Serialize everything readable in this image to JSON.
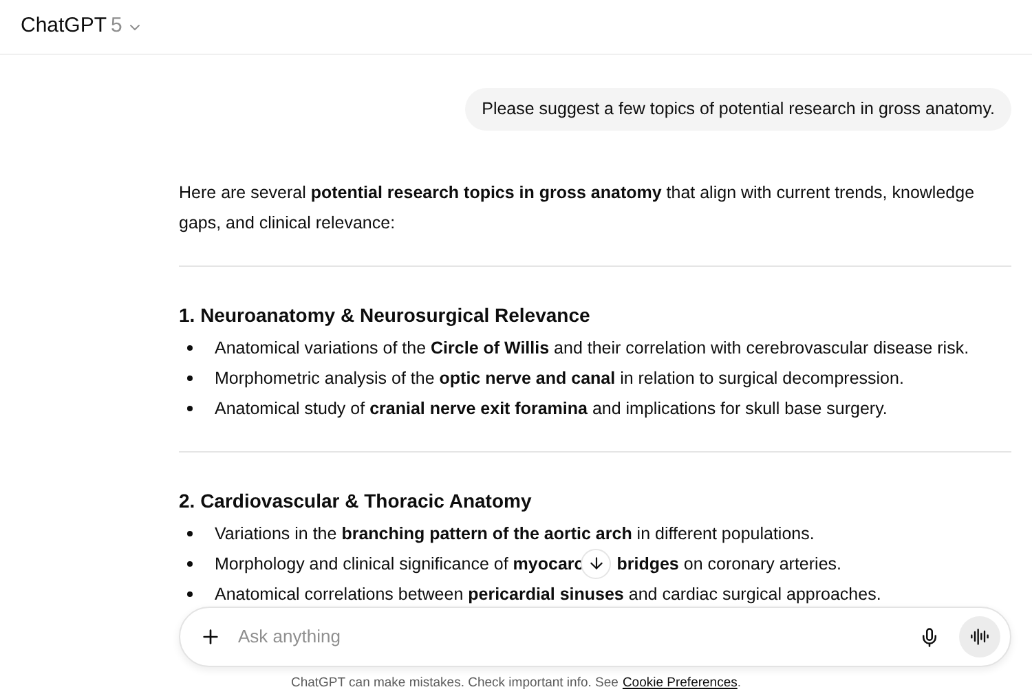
{
  "header": {
    "title": "ChatGPT",
    "version": "5"
  },
  "user_message": "Please suggest a few topics of potential research in gross anatomy.",
  "reply": {
    "intro": "Here are several **potential research topics in gross anatomy** that align with current trends, knowledge gaps, and clinical relevance:",
    "sections": [
      {
        "heading": "1. Neuroanatomy & Neurosurgical Relevance",
        "bullets": [
          {
            "parts": [
              "Anatomical variations of the **Circle of Willis** and their correlation with cerebrovascular disease risk."
            ]
          },
          {
            "parts": [
              "Morphometric analysis of the **optic nerve and canal** in relation to surgical decompression."
            ]
          },
          {
            "parts": [
              "Anatomical study of **cranial nerve exit foramina** and implications for skull base surgery."
            ]
          }
        ]
      },
      {
        "heading": "2. Cardiovascular & Thoracic Anatomy",
        "bullets": [
          {
            "parts": [
              "Variations in the **branching pattern of the aortic arch** in different populations."
            ]
          },
          {
            "parts": [
              "Morphology and clinical significance of **myocarc**",
              "**bridges** on coronary arteries."
            ]
          },
          {
            "parts": [
              "Anatomical correlations between **pericardial sinuses** and cardiac surgical approaches."
            ]
          }
        ]
      }
    ]
  },
  "composer": {
    "placeholder": "Ask anything"
  },
  "footer": {
    "text": "ChatGPT can make mistakes. Check important info. See",
    "link": "Cookie Preferences",
    "end": "."
  }
}
